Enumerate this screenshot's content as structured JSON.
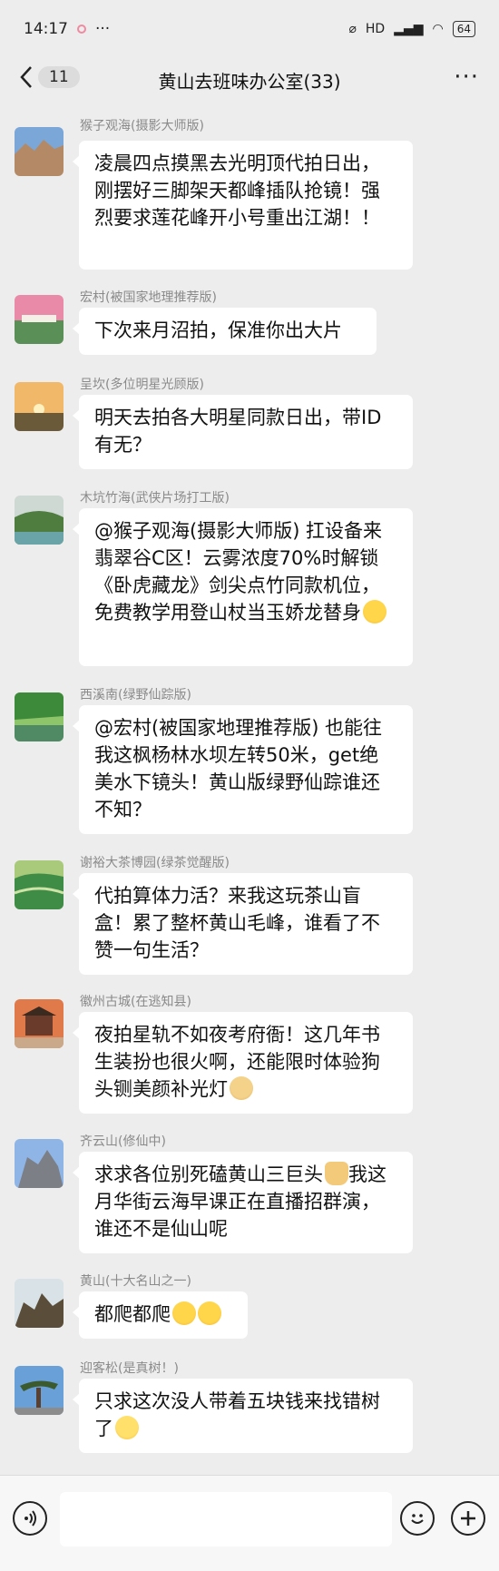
{
  "status_bar": {
    "time": "14:17",
    "dots": "···",
    "network": "HD",
    "battery": "64"
  },
  "nav": {
    "back_count": "11",
    "title": "黄山去班味办公室(33)",
    "more": "···"
  },
  "messages": [
    {
      "sender": "猴子观海(摄影大师版)",
      "text": "凌晨四点摸黑去光明顶代拍日出，刚摆好三脚架天都峰插队抢镜！强烈要求莲花峰开小号重出江湖！！",
      "avatar_colors": [
        "#7aa7d8",
        "#b48a66"
      ]
    },
    {
      "sender": "宏村(被国家地理推荐版)",
      "text": "下次来月沼拍，保准你出大片",
      "avatar_colors": [
        "#e98aa8",
        "#5b8f58"
      ]
    },
    {
      "sender": "呈坎(多位明星光顾版)",
      "text": "明天去拍各大明星同款日出，带ID有无？",
      "avatar_colors": [
        "#f2b86a",
        "#6a5a3a"
      ]
    },
    {
      "sender": "木坑竹海(武侠片场打工版)",
      "text": "@猴子观海(摄影大师版) 扛设备来翡翠谷C区！云雾浓度70%时解锁《卧虎藏龙》剑尖点竹同款机位，免费教学用登山杖当玉娇龙替身",
      "emoji": "wink",
      "avatar_colors": [
        "#cfd9d4",
        "#4e7d3f"
      ]
    },
    {
      "sender": "西溪南(绿野仙踪版)",
      "text": "@宏村(被国家地理推荐版) 也能往我这枫杨林水坝左转50米，get绝美水下镜头！黄山版绿野仙踪谁还不知？",
      "avatar_colors": [
        "#3d8a3a",
        "#8ec46a"
      ]
    },
    {
      "sender": "谢裕大茶博园(绿茶觉醒版)",
      "text": "代拍算体力活？来我这玩茶山盲盒！累了整杯黄山毛峰，谁看了不赞一句生活？",
      "avatar_colors": [
        "#3f8c46",
        "#a9c97b"
      ]
    },
    {
      "sender": "徽州古城(在逃知县)",
      "text": "夜拍星轨不如夜考府衙！这几年书生装扮也很火啊，还能限时体验狗头铡美颜补光灯",
      "emoji": "doge",
      "avatar_colors": [
        "#e07a4a",
        "#6a3a2a"
      ]
    },
    {
      "sender": "齐云山(修仙中)",
      "text": "求求各位别死磕黄山三巨头",
      "text2": "我这月华街云海早课正在直播招群演，谁还不是仙山呢",
      "emoji": "pray",
      "avatar_colors": [
        "#8fb5e6",
        "#7d7f86"
      ]
    },
    {
      "sender": "黄山(十大名山之一)",
      "text": "都爬都爬",
      "emoji": "hug",
      "emoji_count": 2,
      "avatar_colors": [
        "#d9e2e6",
        "#5a4e3a"
      ]
    },
    {
      "sender": "迎客松(是真树！)",
      "text": "只求这次没人带着五块钱来找错树了",
      "emoji": "plead",
      "avatar_colors": [
        "#6aa0d8",
        "#3b5a2e"
      ]
    }
  ],
  "input_bar": {
    "placeholder": ""
  }
}
